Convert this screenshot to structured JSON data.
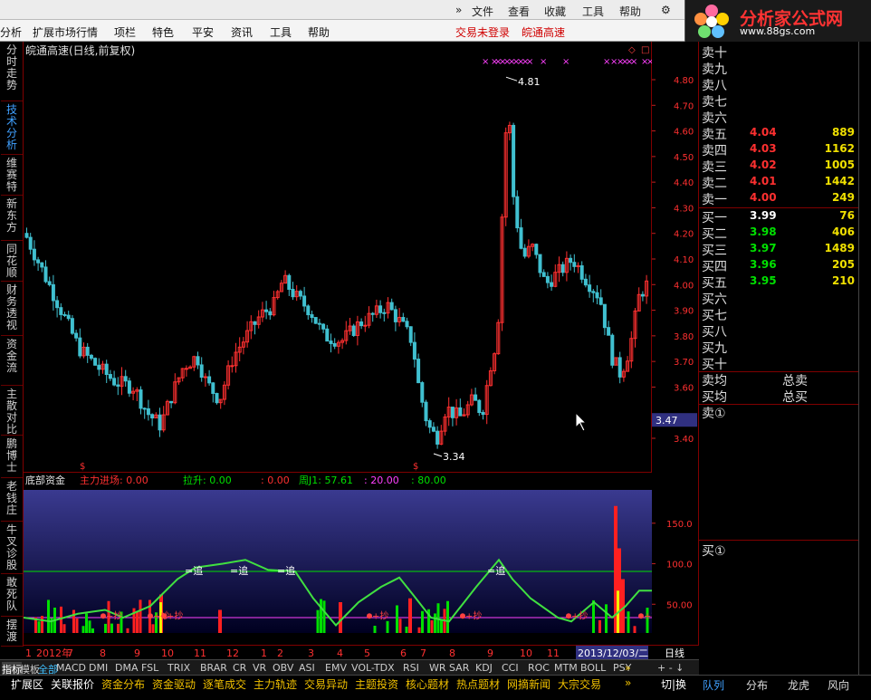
{
  "menu_top": [
    "文件",
    "查看",
    "收藏",
    "工具",
    "帮助"
  ],
  "menu_main": [
    "分析",
    "扩展市场行情",
    "项栏",
    "特色",
    "平安",
    "资讯",
    "工具",
    "帮助"
  ],
  "status_red": [
    "交易未登录",
    "皖通高速"
  ],
  "logo": {
    "title": "分析家公式网",
    "url": "www.88gs.com"
  },
  "chart_title": "皖通高速(日线,前复权)",
  "left_tabs": [
    "分时走势",
    "技术分析",
    "维赛特",
    "新东方",
    "同花顺",
    "财务透视",
    "资金流",
    "主散对比",
    "鹏博士",
    "老钱庄",
    "牛叉诊股",
    "敢死队",
    "摆渡"
  ],
  "price_labels": [
    "4.81",
    "3.34"
  ],
  "y_ticks": [
    "4.80",
    "4.70",
    "4.60",
    "4.50",
    "4.40",
    "4.30",
    "4.20",
    "4.10",
    "4.00",
    "3.90",
    "3.80",
    "3.70",
    "3.60",
    "3.47",
    "3.40"
  ],
  "indicator": {
    "name": "底部资金",
    "main": "主力进场: 0.00",
    "pull": "拉升: 0.00",
    "pz": ": 0.00",
    "zj": "周J1: 57.61",
    "v20": ": 20.00",
    "v80": ": 80.00",
    "y_ticks": [
      "150.0",
      "100.0",
      "50.00"
    ],
    "tags": [
      "=追",
      "=追",
      "=追",
      "=追"
    ],
    "buy_tag": "+抄"
  },
  "x_axis": [
    "1",
    "2012年",
    "7",
    "8",
    "9",
    "10",
    "11",
    "12",
    "1",
    "2",
    "3",
    "4",
    "5",
    "6",
    "7",
    "8",
    "9",
    "10",
    "11",
    "2013/12/03/二"
  ],
  "period": "日线",
  "indicator_tabs": [
    "指标",
    "模板",
    "全部",
    "MACD",
    "DMI",
    "DMA",
    "FSL",
    "TRIX",
    "BRAR",
    "CR",
    "VR",
    "OBV",
    "ASI",
    "EMV",
    "VOL-TDX",
    "RSI",
    "WR",
    "SAR",
    "KDJ",
    "CCI",
    "ROC",
    "MTM",
    "BOLL",
    "PSY"
  ],
  "bottom_tabs": [
    "扩展区",
    "关联报价",
    "资金分布",
    "资金驱动",
    "逐笔成交",
    "主力轨迹",
    "交易异动",
    "主题投资",
    "核心题材",
    "热点题材",
    "网摘新闻",
    "大宗交易"
  ],
  "bottom_right": [
    "切",
    "换"
  ],
  "orderbook": {
    "sell_labels": [
      "卖十",
      "卖九",
      "卖八",
      "卖七",
      "卖六",
      "卖五",
      "卖四",
      "卖三",
      "卖二",
      "卖一"
    ],
    "sell_prices": [
      "",
      "",
      "",
      "",
      "",
      "4.04",
      "4.03",
      "4.02",
      "4.01",
      "4.00"
    ],
    "sell_vols": [
      "",
      "",
      "",
      "",
      "",
      "889",
      "1162",
      "1005",
      "1442",
      "249"
    ],
    "buy_labels": [
      "买一",
      "买二",
      "买三",
      "买四",
      "买五",
      "买六",
      "买七",
      "买八",
      "买九",
      "买十"
    ],
    "buy_prices": [
      "3.99",
      "3.98",
      "3.97",
      "3.96",
      "3.95",
      "",
      "",
      "",
      "",
      ""
    ],
    "buy_vols": [
      "76",
      "406",
      "1489",
      "205",
      "210",
      "",
      "",
      "",
      "",
      ""
    ],
    "avg_sell": "卖均",
    "avg_buy": "买均",
    "total_sell": "总卖",
    "total_buy": "总买",
    "s1": "卖①",
    "b1": "买①"
  },
  "right_tabs": [
    "队列",
    "分布",
    "龙虎",
    "风向"
  ],
  "colors": {
    "up": "#ff3030",
    "down": "#40c0d0",
    "green": "#00e000",
    "yellow": "#f0f000",
    "magenta": "#ff40ff",
    "border": "#800000"
  }
}
